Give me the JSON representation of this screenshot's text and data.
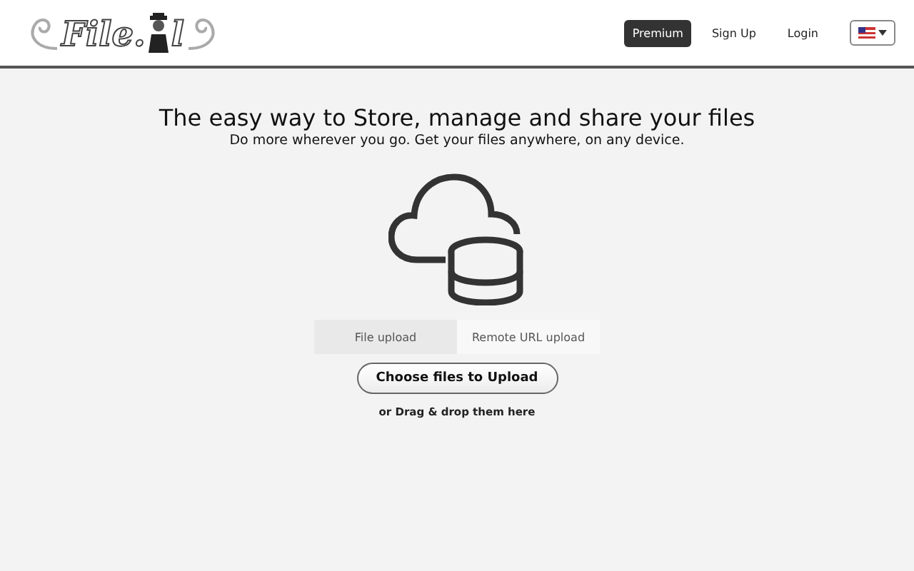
{
  "logo": {
    "text": "File.",
    "suffix": "l"
  },
  "nav": [
    {
      "label": "Premium",
      "kind": "primary"
    },
    {
      "label": "Sign Up",
      "kind": "link"
    },
    {
      "label": "Login",
      "kind": "link"
    }
  ],
  "hero": {
    "title": "The easy way to Store, manage and share your files",
    "subtitle": "Do more wherever you go. Get your files anywhere, on any device."
  },
  "tabs": [
    {
      "label": "File upload",
      "selected": true
    },
    {
      "label": "Remote URL upload",
      "selected": false
    }
  ],
  "upload_button": "Choose files to Upload",
  "drop_hint": "or Drag & drop them here"
}
